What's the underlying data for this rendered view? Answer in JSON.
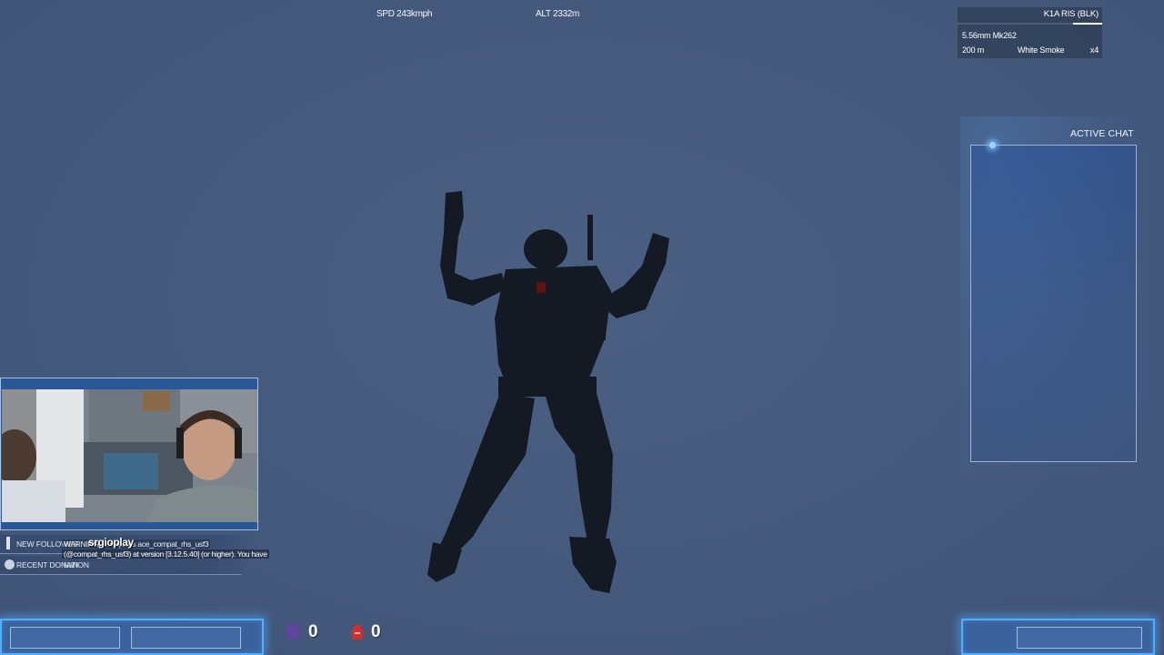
{
  "hud": {
    "speed": "SPD 243kmph",
    "altitude": "ALT 2332m"
  },
  "weapon": {
    "name": "K1A RIS (BLK)",
    "ammo_type": "5.56mm Mk262",
    "zeroing": "200 m",
    "grenade": "White Smoke",
    "grenade_count": "x4",
    "magazine_fill": 0.2
  },
  "chat": {
    "title": "ACTIVE CHAT"
  },
  "overlay": {
    "new_follower_label": "NEW FOLLOWER",
    "new_follower_name": "srgioplay",
    "recent_donation_label": "RECENT DONATION",
    "recent_donation_name": "NaN",
    "twitch_count": "0",
    "donation_count": "0"
  },
  "warning": {
    "line1": "WARNING: ... requires ace_compat_rhs_usf3",
    "line2": "(@compat_rhs_usf3) at version [3.12.5.40] (or higher). You have"
  },
  "colors": {
    "sky": "#45597a",
    "accent_glow": "#4fb0ff",
    "twitch_purple": "#6441a4",
    "donation_red": "#d0302c"
  }
}
